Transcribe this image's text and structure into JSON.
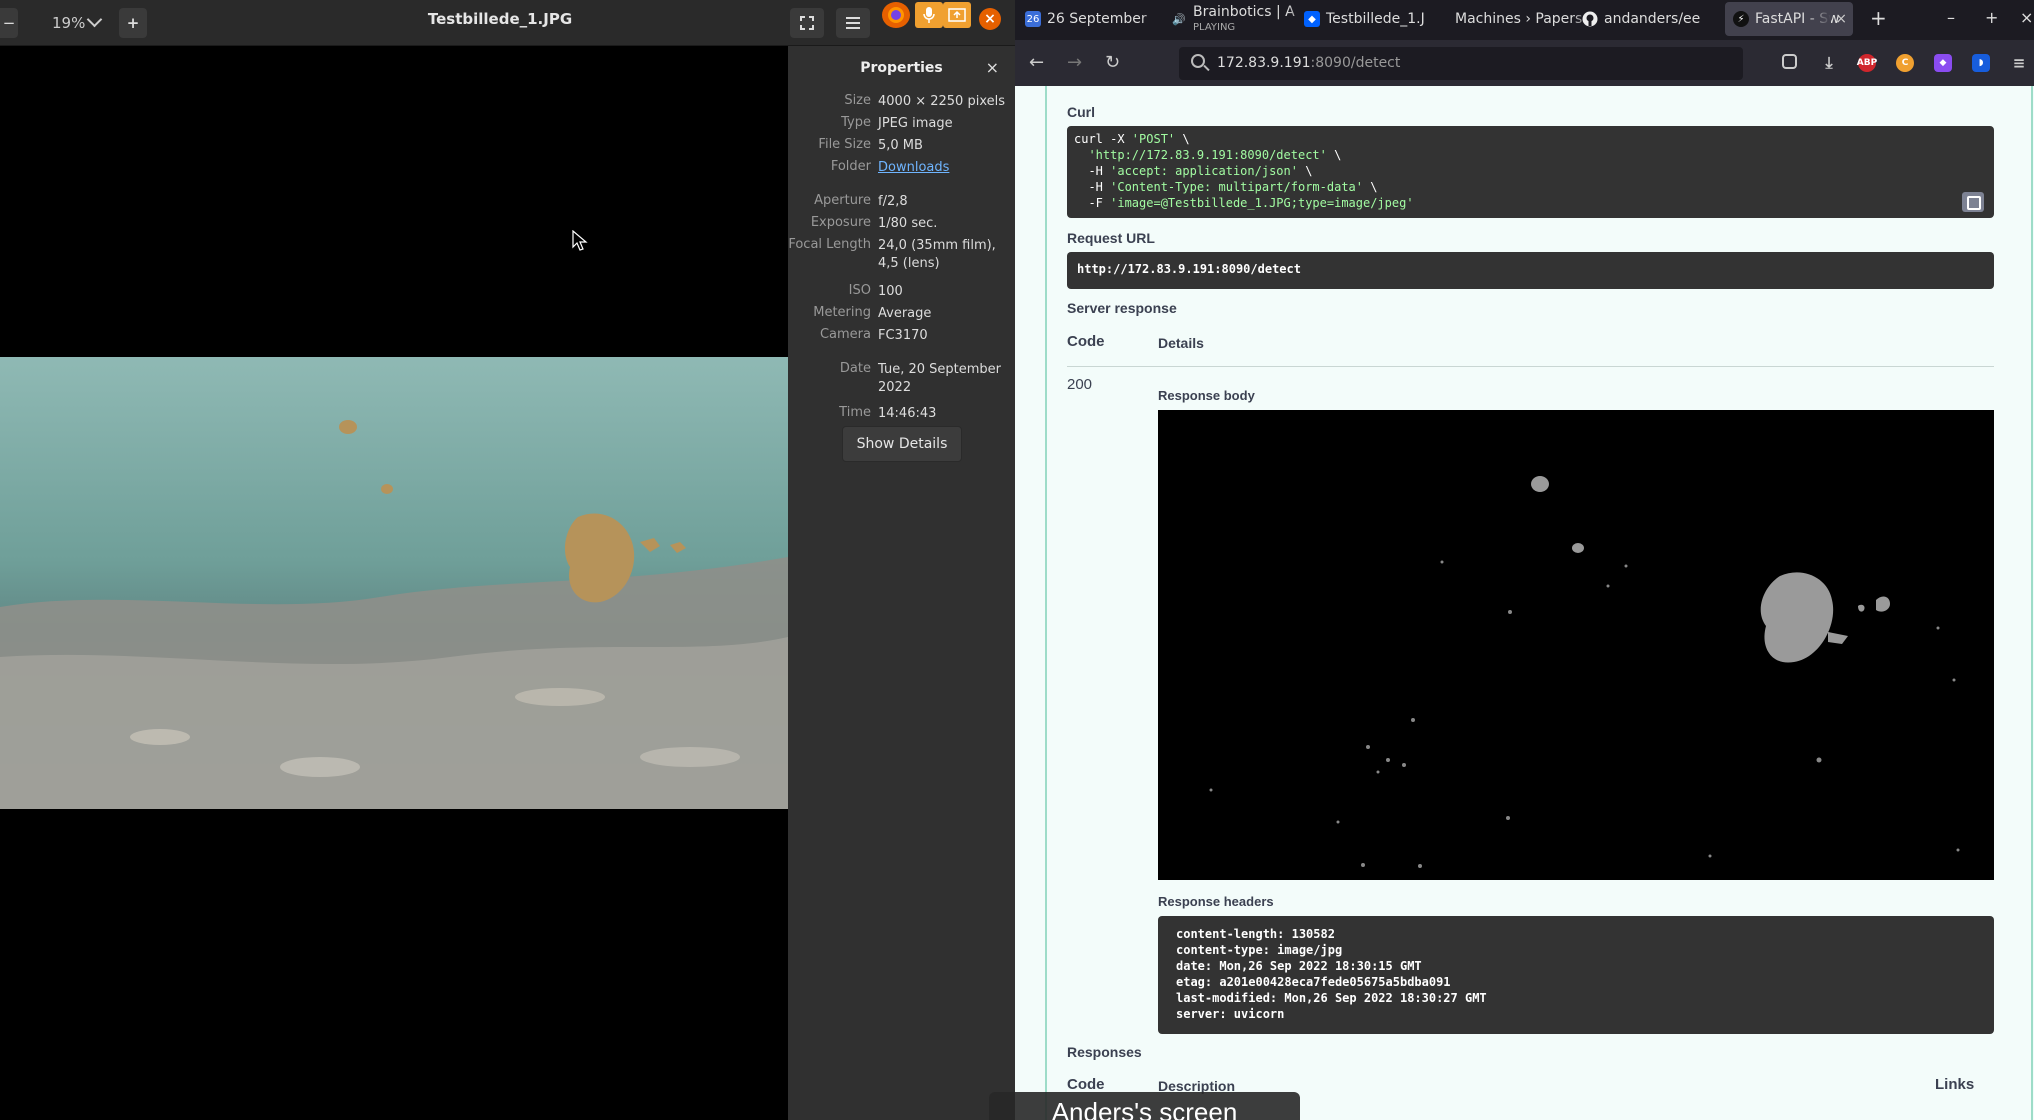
{
  "viewer": {
    "zoom": "19%",
    "title": "Testbillede_1.JPG"
  },
  "properties": {
    "title": "Properties",
    "rows": [
      {
        "k": "Size",
        "v": "4000 × 2250 pixels"
      },
      {
        "k": "Type",
        "v": "JPEG image"
      },
      {
        "k": "File Size",
        "v": "5,0 MB"
      },
      {
        "k": "Folder",
        "v": "Downloads"
      },
      {
        "k": "Aperture",
        "v": "f/2,8"
      },
      {
        "k": "Exposure",
        "v": "1/80 sec."
      },
      {
        "k": "Focal Length",
        "v": "24,0 (35mm film), 4,5 (lens)"
      },
      {
        "k": "ISO",
        "v": "100"
      },
      {
        "k": "Metering",
        "v": "Average"
      },
      {
        "k": "Camera",
        "v": "FC3170"
      },
      {
        "k": "Date",
        "v": "Tue, 20 September 2022"
      },
      {
        "k": "Time",
        "v": "14:46:43"
      }
    ],
    "show_details": "Show Details"
  },
  "browser": {
    "tabs": [
      {
        "label": "26 September",
        "icon": "calendar-icon"
      },
      {
        "label": "Brainbotics | A",
        "sub": "PLAYING",
        "icon": "speaker-icon"
      },
      {
        "label": "Testbillede_1.J",
        "icon": "dropbox-icon"
      },
      {
        "label": "Machines › Papers",
        "icon": "none"
      },
      {
        "label": "andanders/ee",
        "icon": "github-icon"
      },
      {
        "label": "FastAPI - Sw",
        "icon": "fastapi-icon"
      }
    ],
    "url_host": "172.83.9.191",
    "url_path": ":8090/detect",
    "extensions": [
      "pocket-icon",
      "download-icon",
      "adblock-icon",
      "extension-c-icon",
      "extension-purple-icon",
      "bitwarden-icon"
    ]
  },
  "swagger": {
    "curl_label": "Curl",
    "curl_lines": [
      [
        "curl -X ",
        "'POST'",
        " \\"
      ],
      [
        "  ",
        "'http://172.83.9.191:8090/detect'",
        " \\"
      ],
      [
        "  -H ",
        "'accept: application/json'",
        " \\"
      ],
      [
        "  -H ",
        "'Content-Type: multipart/form-data'",
        " \\"
      ],
      [
        "  -F ",
        "'image=@Testbillede_1.JPG;type=image/jpeg'",
        ""
      ]
    ],
    "request_url_label": "Request URL",
    "request_url": "http://172.83.9.191:8090/detect",
    "server_response_label": "Server response",
    "col_code": "Code",
    "col_details": "Details",
    "status_code": "200",
    "response_body_label": "Response body",
    "response_headers_label": "Response headers",
    "headers": [
      "content-length: 130582",
      "content-type: image/jpg",
      "date: Mon,26 Sep 2022 18:30:15 GMT",
      "etag: a201e00428eca7fede05675a5bdba091",
      "last-modified: Mon,26 Sep 2022 18:30:27 GMT",
      "server: uvicorn"
    ],
    "responses_label": "Responses",
    "col_description": "Description",
    "col_links": "Links"
  },
  "screen_share": "Anders's screen"
}
